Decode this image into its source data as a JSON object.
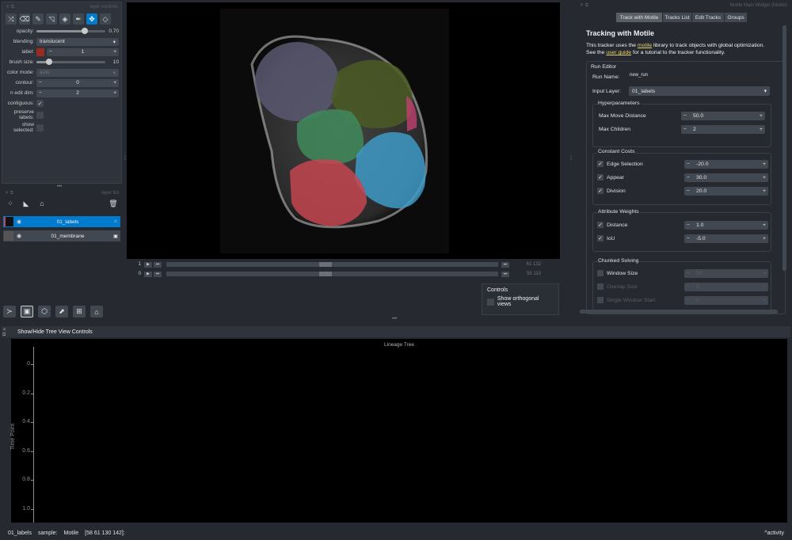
{
  "layer_controls": {
    "title": "layer controls",
    "opacity_label": "opacity:",
    "opacity_value": "0.70",
    "opacity_fraction": 0.7,
    "blending_label": "blending:",
    "blending_value": "translucent",
    "label_label": "label:",
    "label_value": "1",
    "label_color": "#9b2a20",
    "brush_size_label": "brush size:",
    "brush_size_value": "10",
    "brush_fraction": 0.18,
    "color_mode_label": "color mode:",
    "color_mode_value": "auto",
    "contour_label": "contour:",
    "contour_value": "0",
    "n_edit_dim_label": "n edit dim:",
    "n_edit_dim_value": "2",
    "contiguous_label": "contiguous:",
    "preserve_labels_label": "preserve labels:",
    "show_selected_label": "show selected:"
  },
  "layer_list": {
    "title": "layer list",
    "layers": [
      {
        "name": "01_labels",
        "selected": true
      },
      {
        "name": "01_membrane",
        "selected": false
      }
    ]
  },
  "dims": [
    {
      "index": "1",
      "values": "61   132",
      "position": 0.46
    },
    {
      "index": "0",
      "values": "55   110",
      "position": 0.46
    }
  ],
  "controls_box": {
    "title": "Controls",
    "orthogonal_label": "Show orthogonal views"
  },
  "right_panel": {
    "window_title": "Motile Main Widget (Motile)",
    "tabs": [
      "Track with Motile",
      "Tracks List",
      "Edit Tracks",
      "Groups"
    ],
    "heading": "Tracking with Motile",
    "desc_1": "This tracker uses the",
    "desc_link_1": "motile",
    "desc_2": "library to track objects with global optimization.",
    "desc_3": "See the",
    "desc_link_2": "user guide",
    "desc_4": "for a tutorial to the tracker functionality.",
    "run_editor_title": "Run Editor",
    "run_name_label": "Run Name:",
    "run_name_value": "new_run",
    "input_layer_label": "Input Layer:",
    "input_layer_value": "01_labels",
    "hyperparameters_title": "Hyperparameters",
    "max_move_label": "Max Move Distance",
    "max_move_value": "50.0",
    "max_children_label": "Max Children",
    "max_children_value": "2",
    "constant_costs_title": "Constant Costs",
    "edge_selection_label": "Edge Selection",
    "edge_selection_value": "-20.0",
    "appear_label": "Appear",
    "appear_value": "30.0",
    "division_label": "Division",
    "division_value": "20.0",
    "attribute_weights_title": "Attribute Weights",
    "distance_label": "Distance",
    "distance_value": "1.0",
    "iou_label": "IoU",
    "iou_value": "-5.0",
    "chunked_title": "Chunked Solving",
    "window_size_label": "Window Size",
    "window_size_value": "50",
    "overlap_size_label": "Overlap Size",
    "overlap_size_value": "5",
    "single_window_label": "Single Window Start",
    "single_window_value": "0"
  },
  "tree": {
    "toggle_label": "Show/Hide Tree View Controls",
    "title": "Lineage Tree",
    "ylabel": "Time Point",
    "yticks": [
      "0",
      "0.2",
      "0.4",
      "0.6",
      "0.8",
      "1.0"
    ]
  },
  "status": {
    "layer": "01_labels",
    "sample_label": "sample:",
    "plugin": "Motile",
    "coords": "[58 61 130 142]:",
    "activity": "activity"
  },
  "colors": {
    "accent": "#007acc",
    "cell_purple": "#5a5870",
    "cell_olive": "#4b5a24",
    "cell_green": "#3f8a5c",
    "cell_blue": "#3f9ac8",
    "cell_red": "#c44550"
  }
}
